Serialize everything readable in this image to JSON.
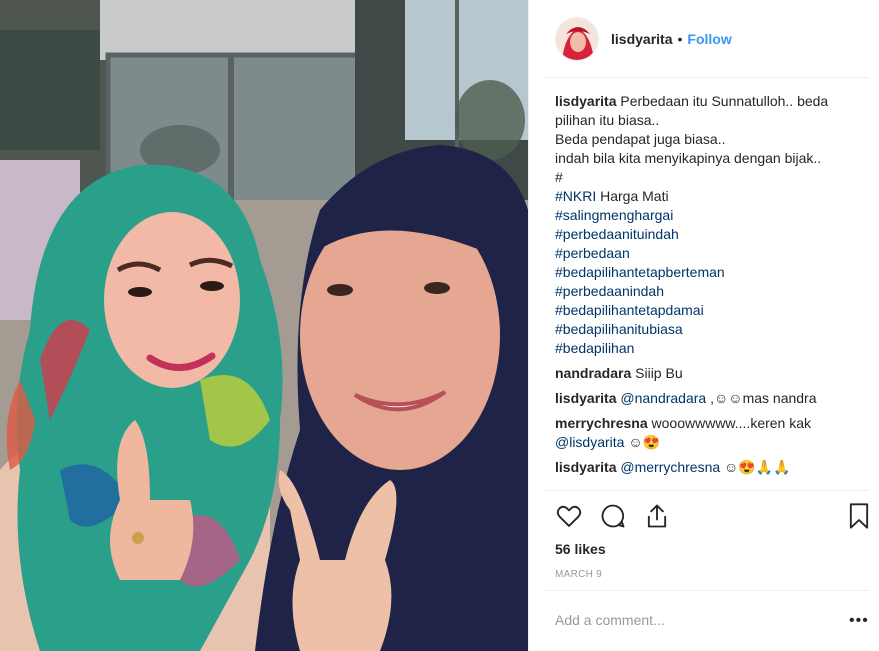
{
  "post": {
    "username": "lisdyarita",
    "separator": "•",
    "follow_label": "Follow"
  },
  "caption": {
    "username": "lisdyarita",
    "lines": [
      "Perbedaan itu Sunnatulloh.. beda pilihan itu biasa..",
      "Beda pendapat juga biasa..",
      "indah bila kita menyikapinya dengan bijak..",
      "#"
    ],
    "nkri_tag": "#NKRI",
    "nkri_rest": " Harga Mati",
    "hashtags": [
      "#salingmenghargai",
      "#perbedaanituindah",
      "#perbedaan",
      "#bedapilihantetapberteman",
      "#perbedaanindah",
      "#bedapilihantetapdamai",
      "#bedapilihanitubiasa",
      "#bedapilihan"
    ]
  },
  "comments": [
    {
      "username": "nandradara",
      "text": "Siiip Bu"
    },
    {
      "username": "lisdyarita",
      "mention": "@nandradara",
      "text": " ,☺☺mas nandra"
    },
    {
      "username": "merrychresna",
      "text": "wooowwwww....keren kak",
      "mention": "@lisdyarita",
      "text2": " ☺😍"
    },
    {
      "username": "lisdyarita",
      "mention": "@merrychresna",
      "text": " ☺😍🙏🙏"
    }
  ],
  "likes_label": "56 likes",
  "date": "MARCH 9",
  "add_comment_placeholder": "Add a comment...",
  "more_label": "•••",
  "colors": {
    "link": "#3897f0",
    "hashtag": "#003569",
    "text": "#262626",
    "muted": "#999999"
  },
  "icons": [
    "heart-icon",
    "comment-icon",
    "share-icon",
    "bookmark-icon",
    "more-options-icon"
  ]
}
